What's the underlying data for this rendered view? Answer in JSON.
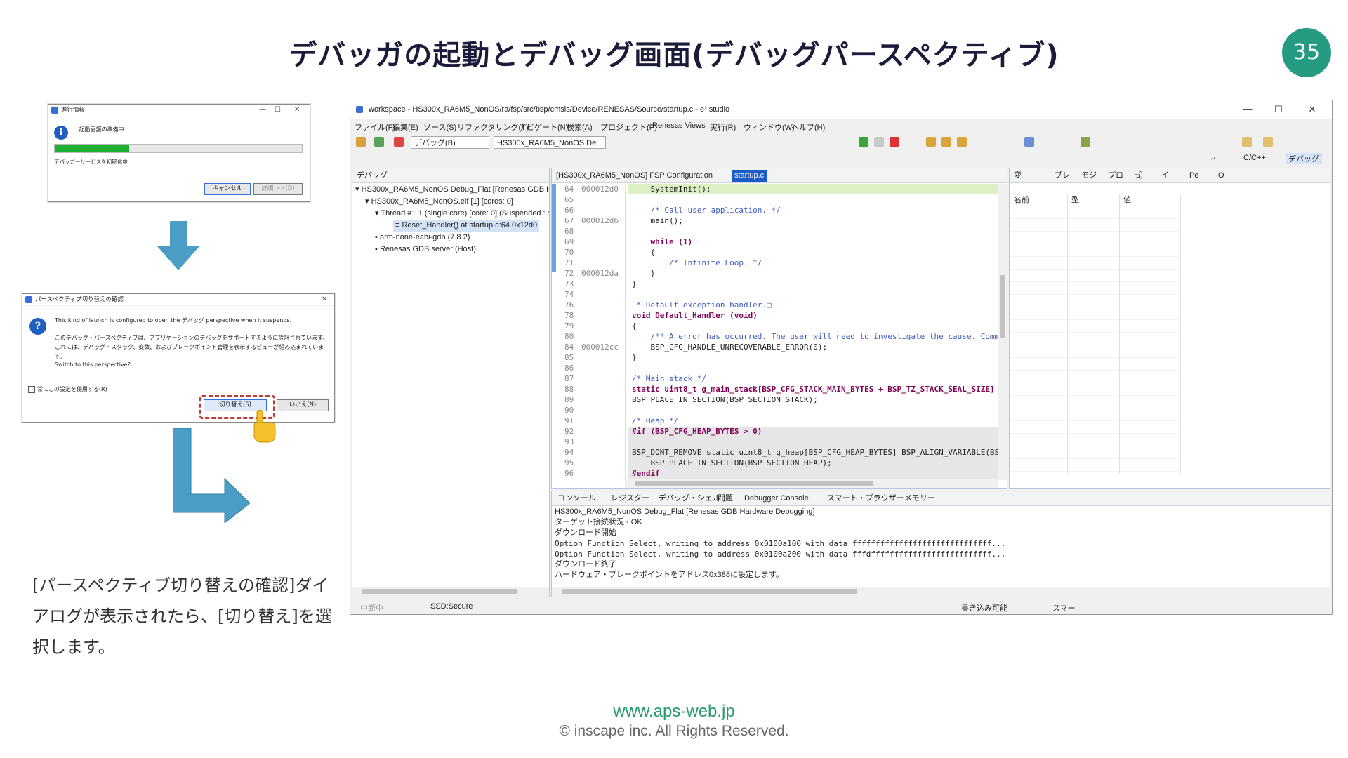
{
  "slide": {
    "title": "デバッガの起動とデバッグ画面(デバッグパースペクティブ)",
    "page_number": "35",
    "caption": "[パースペクティブ切り替えの確認]ダイアログが表示されたら、[切り替え]を選択します。",
    "footer_url": "www.aps-web.jp",
    "footer_copy": "© inscape inc. All Rights Reserved."
  },
  "progress_dialog": {
    "title": "進行情報",
    "message": "...起動委譲の準備中...",
    "status": "デバッガーサービスを初期化中",
    "progress": 0.3,
    "cancel_label": "キャンセル",
    "details_label": "詳細 >>(D)",
    "ctrl_min": "—",
    "ctrl_max": "☐",
    "ctrl_close": "✕"
  },
  "perspective_dialog": {
    "title": "パースペクティブ切り替えの確認",
    "line1": "This kind of launch is configured to open the デバッグ perspective when it suspends.",
    "line2": "このデバッグ・パースペクティブは、アプリケーションのデバッグをサポートするように設計されています。これには、デバッグ・スタック、変数、およびブレークポイント管理を表示するビューが組み込まれています。",
    "line3": "Switch to this perspective?",
    "remember_label": "常にこの設定を使用する(R)",
    "switch_label": "切り替え(S)",
    "no_label": "いいえ(N)",
    "close": "✕"
  },
  "ide": {
    "window_title": "workspace - HS300x_RA6M5_NonOS/ra/fsp/src/bsp/cmsis/Device/RENESAS/Source/startup.c - e² studio",
    "win_min": "—",
    "win_max": "☐",
    "win_close": "✕",
    "menu": [
      "ファイル(F)",
      "編集(E)",
      "ソース(S)",
      "リファクタリング(T)",
      "ナビゲート(N)",
      "検索(A)",
      "プロジェクト(P)",
      "Renesas Views",
      "実行(R)",
      "ウィンドウ(W)",
      "ヘルプ(H)"
    ],
    "toolbar_debug_select": "デバッグ(B)",
    "toolbar_config_select": "HS300x_RA6M5_NonOS De",
    "perspectives": [
      "C/C++",
      "デバッグ"
    ],
    "debug_view": {
      "tab": "デバッグ",
      "tree": [
        "HS300x_RA6M5_NonOS Debug_Flat [Renesas GDB Hardware D",
        "HS300x_RA6M5_NonOS.elf [1] [cores: 0]",
        "Thread #1 1 (single core) [core: 0] (Suspended : シグナル :",
        "Reset_Handler() at startup.c:64 0x12d0",
        "arm-none-eabi-gdb (7.8.2)",
        "Renesas GDB server (Host)"
      ]
    },
    "editor": {
      "tabs": [
        "[HS300x_RA6M5_NonOS] FSP Configuration",
        "startup.c"
      ],
      "lines": [
        {
          "n": "64",
          "addr": "000012d0",
          "code": "    SystemInit();"
        },
        {
          "n": "65",
          "addr": "",
          "code": ""
        },
        {
          "n": "66",
          "addr": "",
          "code": "    /* Call user application. */"
        },
        {
          "n": "67",
          "addr": "000012d6",
          "code": "    main();"
        },
        {
          "n": "68",
          "addr": "",
          "code": ""
        },
        {
          "n": "69",
          "addr": "",
          "code": "    while (1)"
        },
        {
          "n": "70",
          "addr": "",
          "code": "    {"
        },
        {
          "n": "71",
          "addr": "",
          "code": "        /* Infinite Loop. */"
        },
        {
          "n": "72",
          "addr": "000012da",
          "code": "    }"
        },
        {
          "n": "73",
          "addr": "",
          "code": "}"
        },
        {
          "n": "74",
          "addr": "",
          "code": ""
        },
        {
          "n": "76",
          "addr": "",
          "code": " * Default exception handler.□"
        },
        {
          "n": "78",
          "addr": "",
          "code": "void Default_Handler (void)"
        },
        {
          "n": "79",
          "addr": "",
          "code": "{"
        },
        {
          "n": "80",
          "addr": "",
          "code": "    /** A error has occurred. The user will need to investigate the cause. Comm"
        },
        {
          "n": "84",
          "addr": "000012cc",
          "code": "    BSP_CFG_HANDLE_UNRECOVERABLE_ERROR(0);"
        },
        {
          "n": "85",
          "addr": "",
          "code": "}"
        },
        {
          "n": "86",
          "addr": "",
          "code": ""
        },
        {
          "n": "87",
          "addr": "",
          "code": "/* Main stack */"
        },
        {
          "n": "88",
          "addr": "",
          "code": "static uint8_t g_main_stack[BSP_CFG_STACK_MAIN_BYTES + BSP_TZ_STACK_SEAL_SIZE]"
        },
        {
          "n": "89",
          "addr": "",
          "code": "BSP_PLACE_IN_SECTION(BSP_SECTION_STACK);"
        },
        {
          "n": "90",
          "addr": "",
          "code": ""
        },
        {
          "n": "91",
          "addr": "",
          "code": "/* Heap */"
        },
        {
          "n": "92",
          "addr": "",
          "code": "#if (BSP_CFG_HEAP_BYTES > 0)"
        },
        {
          "n": "93",
          "addr": "",
          "code": ""
        },
        {
          "n": "94",
          "addr": "",
          "code": "BSP_DONT_REMOVE static uint8_t g_heap[BSP_CFG_HEAP_BYTES] BSP_ALIGN_VARIABLE(BS"
        },
        {
          "n": "95",
          "addr": "",
          "code": "    BSP_PLACE_IN_SECTION(BSP_SECTION_HEAP);"
        },
        {
          "n": "96",
          "addr": "",
          "code": "#endif"
        }
      ]
    },
    "variables_view": {
      "tabs": [
        "変",
        "ブレ",
        "モジ",
        "プロ",
        "式",
        "イ",
        "Pe",
        "IO"
      ],
      "columns": [
        "名前",
        "型",
        "値"
      ]
    },
    "console_view": {
      "tabs": [
        "コンソール",
        "レジスター",
        "デバッグ・シェル",
        "問題",
        "Debugger Console",
        "スマート・ブラウザー",
        "メモリー"
      ],
      "header": "HS300x_RA6M5_NonOS Debug_Flat [Renesas GDB Hardware Debugging]",
      "lines": [
        "ターゲット接続状況 - OK",
        "ダウンロード開始",
        "Option Function Select, writing to address 0x0100a100 with data ffffffffffffffffffffffffffffff...",
        "Option Function Select, writing to address 0x0100a200 with data fffdffffffffffffffffffffffffff...",
        "ダウンロード終了",
        "ハードウェア・ブレークポイントをアドレス0x388に設定します。"
      ]
    },
    "status_bar": {
      "left1": "中断中",
      "left2": "SSD:Secure",
      "mode": "書き込み可能",
      "insert": "スマー"
    }
  }
}
